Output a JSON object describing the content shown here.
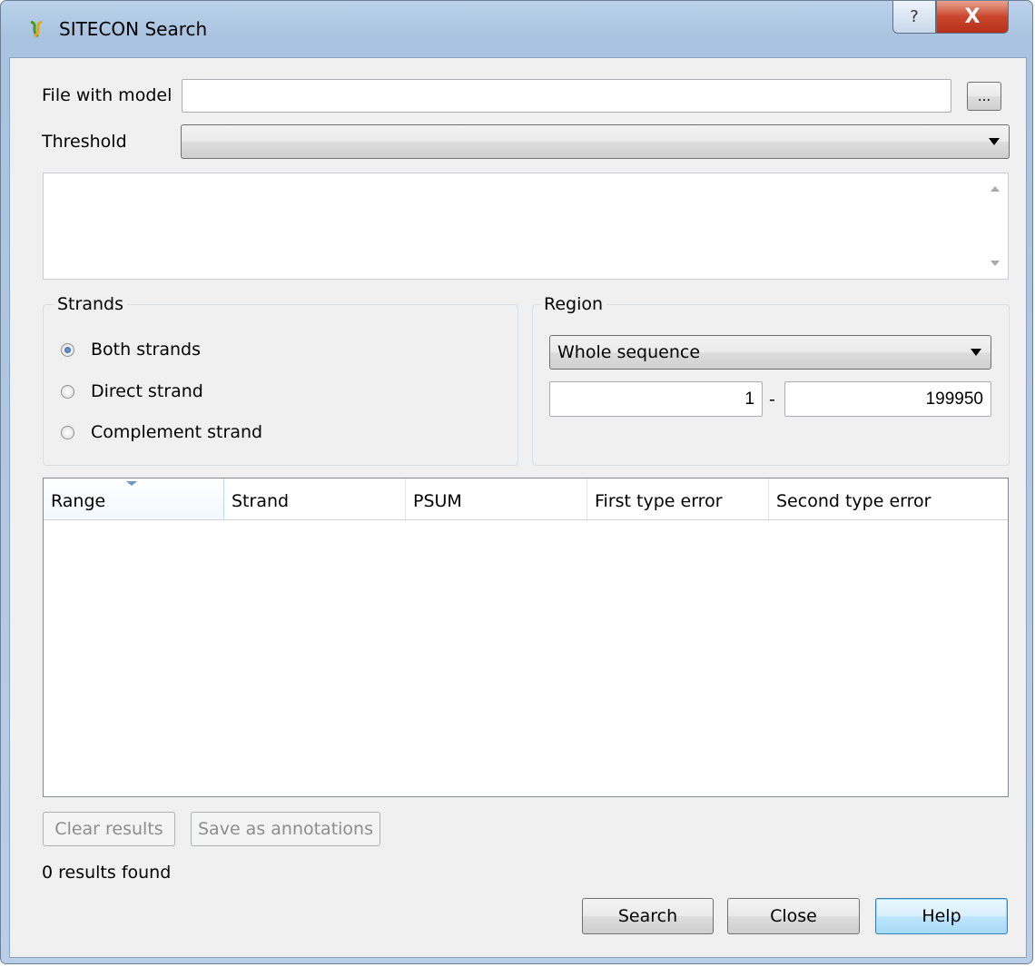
{
  "window": {
    "title": "SITECON Search",
    "help_button": "?",
    "close_button": "X"
  },
  "model": {
    "label": "File with model",
    "value": "",
    "browse_label": "..."
  },
  "threshold": {
    "label": "Threshold",
    "selected": ""
  },
  "strands": {
    "title": "Strands",
    "options": [
      {
        "label": "Both strands",
        "checked": true
      },
      {
        "label": "Direct strand",
        "checked": false
      },
      {
        "label": "Complement strand",
        "checked": false
      }
    ]
  },
  "region": {
    "title": "Region",
    "selected": "Whole sequence",
    "start": "1",
    "separator": "-",
    "end": "199950"
  },
  "results_table": {
    "columns": [
      "Range",
      "Strand",
      "PSUM",
      "First type error",
      "Second type error"
    ],
    "rows": []
  },
  "actions": {
    "clear_results": "Clear results",
    "save_annotations": "Save as annotations"
  },
  "status": "0 results found",
  "buttons": {
    "search": "Search",
    "close": "Close",
    "help": "Help"
  },
  "colors": {
    "title_gradient": "#b9cfe7",
    "client_bg": "#f0f0f0",
    "close_red": "#c9462c",
    "default_button": "#bee6fd"
  }
}
